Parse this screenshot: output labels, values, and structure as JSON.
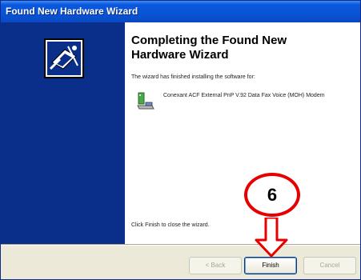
{
  "window": {
    "title": "Found New Hardware Wizard"
  },
  "heading": {
    "line1": "Completing the Found New",
    "line2": "Hardware Wizard"
  },
  "message": "The wizard has finished installing the software for:",
  "device": {
    "name": "Conexant ACF External PnP V.92 Data Fax Voice (MOH) Modem",
    "icon": "modem-icon"
  },
  "finish_message": "Click Finish to close the wizard.",
  "buttons": {
    "back": "< Back",
    "finish": "Finish",
    "cancel": "Cancel"
  },
  "annotation": {
    "step": "6",
    "color": "#e80000"
  },
  "colors": {
    "titlebar": "#0a58e0",
    "sidebar": "#0a2f8a",
    "face": "#ece9d8"
  }
}
